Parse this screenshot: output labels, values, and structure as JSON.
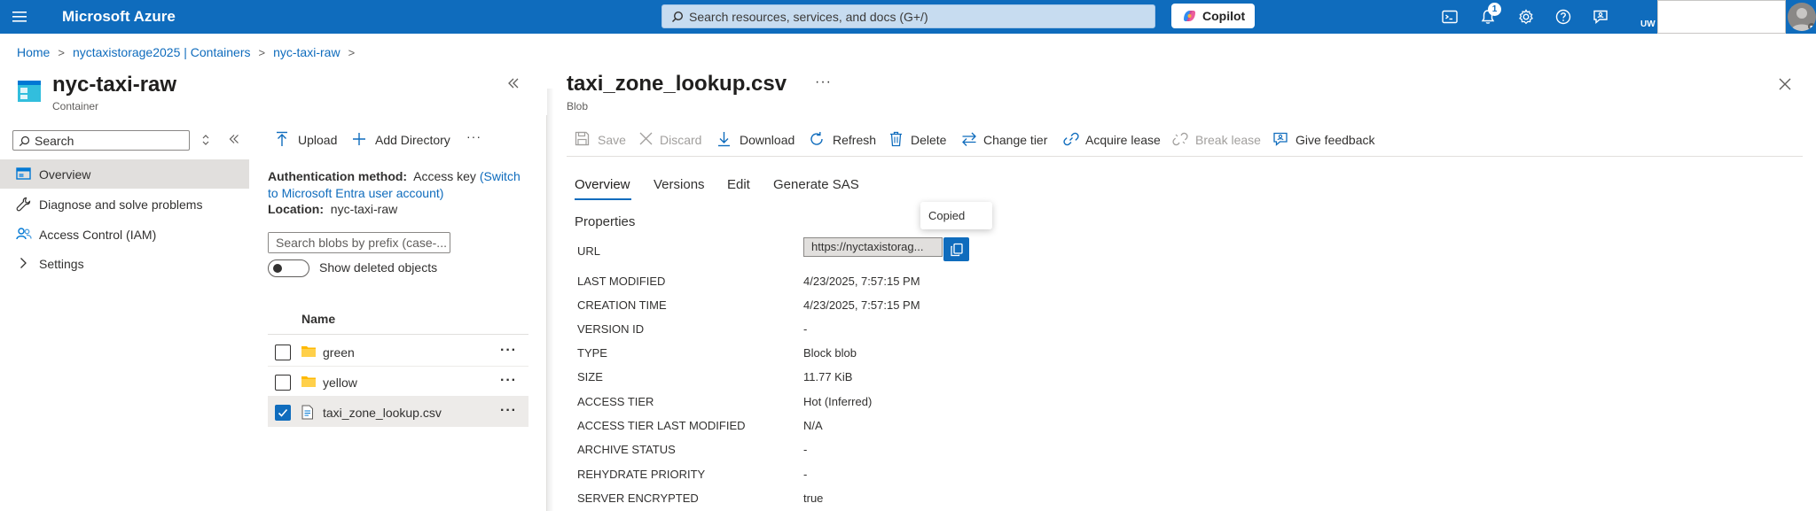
{
  "app": {
    "brand": "Microsoft Azure",
    "search_placeholder": "Search resources, services, and docs (G+/)",
    "copilot_label": "Copilot",
    "notifications_count": "1",
    "user_initials": "UW"
  },
  "breadcrumb": {
    "items": [
      "Home",
      "nyctaxistorage2025 | Containers",
      "nyc-taxi-raw"
    ]
  },
  "container_blade": {
    "title": "nyc-taxi-raw",
    "subtitle": "Container",
    "search_placeholder": "Search",
    "menu": [
      {
        "label": "Overview",
        "icon": "overview-icon",
        "active": true
      },
      {
        "label": "Diagnose and solve problems",
        "icon": "wrench-icon"
      },
      {
        "label": "Access Control (IAM)",
        "icon": "people-icon"
      },
      {
        "label": "Settings",
        "icon": "chevron-right-icon"
      }
    ]
  },
  "container_content": {
    "toolbar": {
      "upload": "Upload",
      "add_directory": "Add Directory",
      "more": "···"
    },
    "auth_label": "Authentication method:",
    "auth_value": "Access key",
    "auth_link": "(Switch to Microsoft Entra user account)",
    "location_label": "Location:",
    "location_value": "nyc-taxi-raw",
    "prefix_placeholder": "Search blobs by prefix (case-...",
    "show_deleted_label": "Show deleted objects",
    "column_name": "Name",
    "rows": [
      {
        "name": "green",
        "type": "folder",
        "checked": false
      },
      {
        "name": "yellow",
        "type": "folder",
        "checked": false
      },
      {
        "name": "taxi_zone_lookup.csv",
        "type": "file",
        "checked": true
      }
    ]
  },
  "blob_blade": {
    "title": "taxi_zone_lookup.csv",
    "subtitle": "Blob",
    "more": "···",
    "commands": {
      "save": "Save",
      "discard": "Discard",
      "download": "Download",
      "refresh": "Refresh",
      "delete": "Delete",
      "change_tier": "Change tier",
      "acquire_lease": "Acquire lease",
      "break_lease": "Break lease",
      "give_feedback": "Give feedback"
    },
    "tabs": [
      "Overview",
      "Versions",
      "Edit",
      "Generate SAS"
    ],
    "properties_heading": "Properties",
    "url_label": "URL",
    "url_value": "https://nyctaxistorag...",
    "tooltip": "Copied",
    "properties": [
      {
        "label": "LAST MODIFIED",
        "value": "4/23/2025, 7:57:15 PM"
      },
      {
        "label": "CREATION TIME",
        "value": "4/23/2025, 7:57:15 PM"
      },
      {
        "label": "VERSION ID",
        "value": "-"
      },
      {
        "label": "TYPE",
        "value": "Block blob"
      },
      {
        "label": "SIZE",
        "value": "11.77 KiB"
      },
      {
        "label": "ACCESS TIER",
        "value": "Hot (Inferred)"
      },
      {
        "label": "ACCESS TIER LAST MODIFIED",
        "value": "N/A"
      },
      {
        "label": "ARCHIVE STATUS",
        "value": "-"
      },
      {
        "label": "REHYDRATE PRIORITY",
        "value": "-"
      },
      {
        "label": "SERVER ENCRYPTED",
        "value": "true"
      }
    ]
  }
}
